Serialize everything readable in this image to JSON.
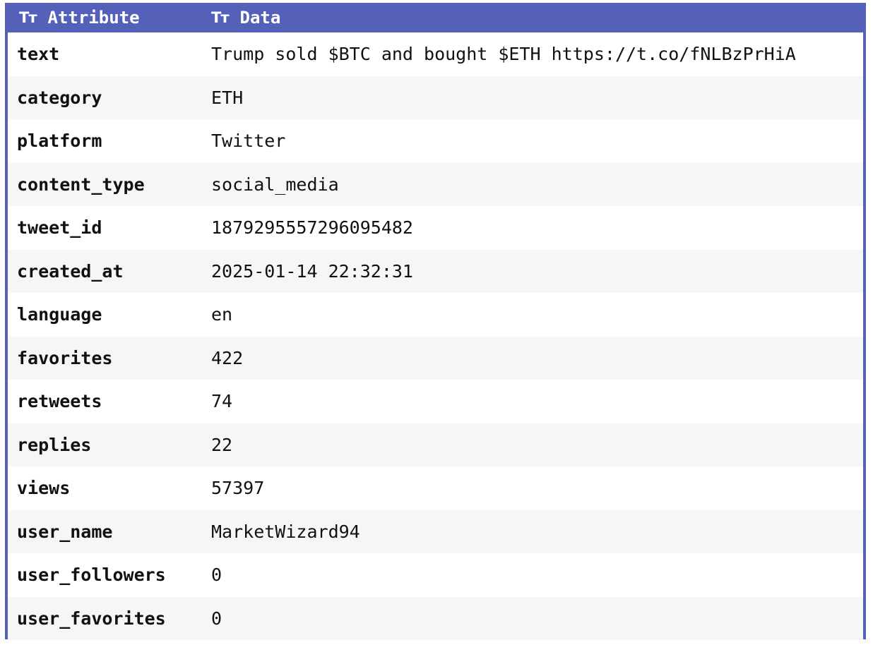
{
  "table": {
    "header": {
      "attribute_icon": "Tт",
      "attribute_label": "Attribute",
      "data_icon": "Tт",
      "data_label": "Data"
    },
    "rows": [
      {
        "attribute": "text",
        "data": "Trump sold $BTC and bought $ETH https://t.co/fNLBzPrHiA"
      },
      {
        "attribute": "category",
        "data": "ETH"
      },
      {
        "attribute": "platform",
        "data": "Twitter"
      },
      {
        "attribute": "content_type",
        "data": "social_media"
      },
      {
        "attribute": "tweet_id",
        "data": "1879295557296095482"
      },
      {
        "attribute": "created_at",
        "data": "2025-01-14 22:32:31"
      },
      {
        "attribute": "language",
        "data": "en"
      },
      {
        "attribute": "favorites",
        "data": "422"
      },
      {
        "attribute": "retweets",
        "data": "74"
      },
      {
        "attribute": "replies",
        "data": "22"
      },
      {
        "attribute": "views",
        "data": "57397"
      },
      {
        "attribute": "user_name",
        "data": "MarketWizard94"
      },
      {
        "attribute": "user_followers",
        "data": "0"
      },
      {
        "attribute": "user_favorites",
        "data": "0"
      }
    ]
  },
  "colors": {
    "header_bg": "#5560b8",
    "header_text": "#ffffff",
    "alt_row_bg": "#f5f6f8",
    "text": "#111111"
  }
}
